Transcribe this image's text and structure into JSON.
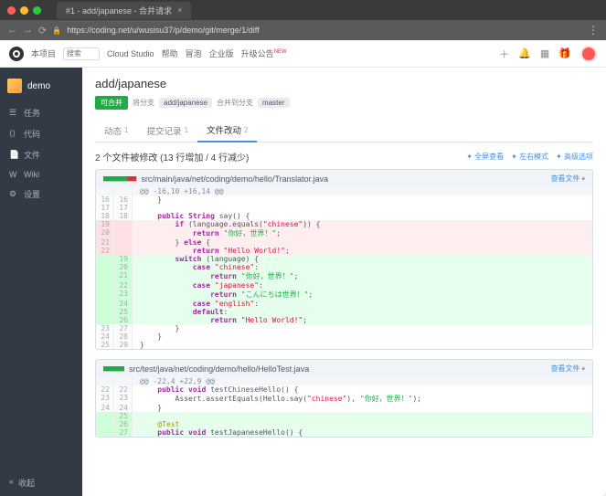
{
  "browser": {
    "tab_title": "#1 - add/japanese - 合并请求",
    "url": "https://coding.net/u/wusisu37/p/demo/git/merge/1/diff"
  },
  "header": {
    "nav_project": "本项目",
    "search_placeholder": "搜索",
    "links": [
      "Cloud Studio",
      "帮助",
      "冒泡",
      "企业版",
      "升级公告"
    ],
    "new": "NEW"
  },
  "sidebar": {
    "project": "demo",
    "items": [
      {
        "icon": "☰",
        "label": "任务"
      },
      {
        "icon": "⟨⟩",
        "label": "代码"
      },
      {
        "icon": "📄",
        "label": "文件"
      },
      {
        "icon": "W",
        "label": "Wiki"
      },
      {
        "icon": "⚙",
        "label": "设置"
      }
    ],
    "collapse": "收起"
  },
  "mr": {
    "title": "add/japanese",
    "status": "可合并",
    "src_label": "将分支",
    "src_branch": "add/japanese",
    "dst_label": "合并到分支",
    "dst_branch": "master",
    "tabs": [
      {
        "label": "动态",
        "count": "1"
      },
      {
        "label": "提交记录",
        "count": "1"
      },
      {
        "label": "文件改动",
        "count": "2"
      }
    ],
    "summary": "2 个文件被修改 (13 行增加 / 4 行减少)",
    "actions": [
      "全屏查看",
      "左右模式",
      "高级选项"
    ],
    "view_file": "查看文件"
  },
  "files": [
    {
      "stats": {
        "g": "■■■■■■",
        "r": "■■"
      },
      "path": "src/main/java/net/coding/demo/hello/Translator.java",
      "lines": [
        {
          "t": "hunk",
          "a": "",
          "b": "",
          "c": "@@ -16,10 +16,14 @@"
        },
        {
          "t": "",
          "a": "16",
          "b": "16",
          "c": "    }"
        },
        {
          "t": "",
          "a": "17",
          "b": "17",
          "c": ""
        },
        {
          "t": "",
          "a": "18",
          "b": "18",
          "c": "    public String say() {"
        },
        {
          "t": "del",
          "a": "19",
          "b": "",
          "c": "        if (language.equals(\"chinese\")) {"
        },
        {
          "t": "del",
          "a": "20",
          "b": "",
          "c": "            return \"你好，世界！\";"
        },
        {
          "t": "del",
          "a": "21",
          "b": "",
          "c": "        } else {"
        },
        {
          "t": "del",
          "a": "22",
          "b": "",
          "c": "            return \"Hello World!\";"
        },
        {
          "t": "add",
          "a": "",
          "b": "19",
          "c": "        switch (language) {"
        },
        {
          "t": "add",
          "a": "",
          "b": "20",
          "c": "            case \"chinese\":"
        },
        {
          "t": "add",
          "a": "",
          "b": "21",
          "c": "                return \"你好，世界！\";"
        },
        {
          "t": "add",
          "a": "",
          "b": "22",
          "c": "            case \"japanese\":"
        },
        {
          "t": "add",
          "a": "",
          "b": "23",
          "c": "                return \"こんにちは世界！\";"
        },
        {
          "t": "add",
          "a": "",
          "b": "24",
          "c": "            case \"english\":"
        },
        {
          "t": "add",
          "a": "",
          "b": "25",
          "c": "            default:"
        },
        {
          "t": "add",
          "a": "",
          "b": "26",
          "c": "                return \"Hello World!\";"
        },
        {
          "t": "",
          "a": "23",
          "b": "27",
          "c": "        }"
        },
        {
          "t": "",
          "a": "24",
          "b": "28",
          "c": "    }"
        },
        {
          "t": "",
          "a": "25",
          "b": "29",
          "c": "}"
        }
      ]
    },
    {
      "stats": {
        "g": "■■■■■",
        "r": ""
      },
      "path": "src/test/java/net/coding/demo/hello/HelloTest.java",
      "lines": [
        {
          "t": "hunk",
          "a": "",
          "b": "",
          "c": "@@ -22,4 +22,9 @@"
        },
        {
          "t": "",
          "a": "22",
          "b": "22",
          "c": "    public void testChineseHello() {"
        },
        {
          "t": "",
          "a": "23",
          "b": "23",
          "c": "        Assert.assertEquals(Hello.say(\"chinese\"), \"你好，世界！\");"
        },
        {
          "t": "",
          "a": "24",
          "b": "24",
          "c": "    }"
        },
        {
          "t": "add",
          "a": "",
          "b": "25",
          "c": ""
        },
        {
          "t": "add",
          "a": "",
          "b": "26",
          "c": "    @Test"
        },
        {
          "t": "add",
          "a": "",
          "b": "27",
          "c": "    public void testJapaneseHello() {"
        }
      ]
    }
  ]
}
